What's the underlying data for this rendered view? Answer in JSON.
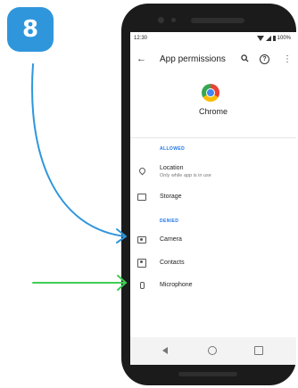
{
  "badge": {
    "step": "8"
  },
  "status": {
    "time": "12:30",
    "battery": "100%"
  },
  "appbar": {
    "back": "←",
    "title": "App permissions",
    "search": "🔍",
    "help": "?",
    "more": "⋮"
  },
  "app": {
    "name": "Chrome",
    "icon": "chrome-logo-icon"
  },
  "sections": {
    "allowed": "ALLOWED",
    "denied": "DENIED"
  },
  "permissions": {
    "location": {
      "label": "Location",
      "sub": "Only while app is in use",
      "icon": "location-pin-icon"
    },
    "storage": {
      "label": "Storage",
      "icon": "folder-icon"
    },
    "camera": {
      "label": "Camera",
      "icon": "camera-icon"
    },
    "contacts": {
      "label": "Contacts",
      "icon": "contacts-icon"
    },
    "microphone": {
      "label": "Microphone",
      "icon": "microphone-icon"
    }
  },
  "colors": {
    "badge": "#2f96dc",
    "arrow_blue": "#2f96dc",
    "arrow_green": "#3ecf54",
    "accent": "#1a73e8"
  }
}
